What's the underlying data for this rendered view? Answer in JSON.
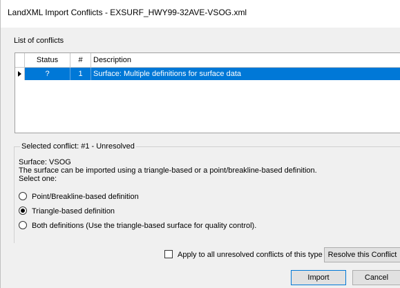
{
  "window": {
    "title": "LandXML Import Conflicts - EXSURF_HWY99-32AVE-VSOG.xml"
  },
  "list": {
    "label": "List of conflicts",
    "columns": {
      "status": "Status",
      "number": "#",
      "description": "Description"
    },
    "rows": [
      {
        "status": "?",
        "number": "1",
        "description": "Surface: Multiple definitions for surface data"
      }
    ]
  },
  "selected": {
    "legend": "Selected conflict: #1 - Unresolved",
    "line1": "Surface: VSOG",
    "line2": "The surface can be imported using a triangle-based or a point/breakline-based definition.",
    "line3": "Select one:"
  },
  "options": [
    {
      "label": "Point/Breakline-based definition",
      "checked": false
    },
    {
      "label": "Triangle-based definition",
      "checked": true
    },
    {
      "label": "Both definitions (Use the triangle-based surface for quality control).",
      "checked": false
    }
  ],
  "apply_all": {
    "label": "Apply to all unresolved conflicts of this type",
    "checked": false
  },
  "buttons": {
    "resolve": "Resolve this Conflict",
    "import": "Import",
    "cancel": "Cancel"
  },
  "colors": {
    "selection": "#0078d7",
    "window_bg": "#f0f0f0"
  }
}
